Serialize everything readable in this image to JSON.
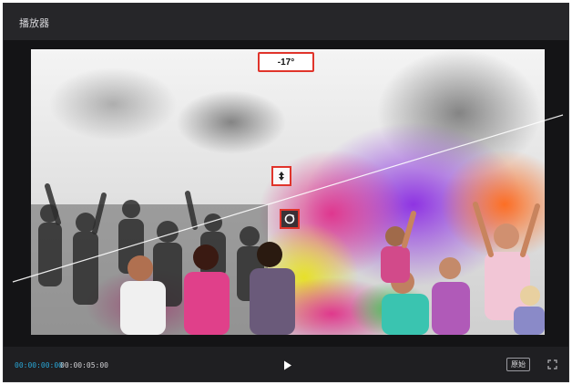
{
  "window": {
    "title": "播放器"
  },
  "viewer": {
    "rotation_label": "-17°",
    "icons": {
      "move_handle": "move-icon",
      "rotate_handle": "rotate-icon"
    }
  },
  "controls": {
    "current_time": "00:00:00:00",
    "total_time": "00:00:05:00",
    "ratio_label": "原始",
    "icons": {
      "play": "play-icon",
      "fullscreen": "fullscreen-icon"
    }
  },
  "colors": {
    "accent_time": "#29a6d6",
    "highlight_border": "#e0342b",
    "panel_bg": "#1f1f22"
  }
}
